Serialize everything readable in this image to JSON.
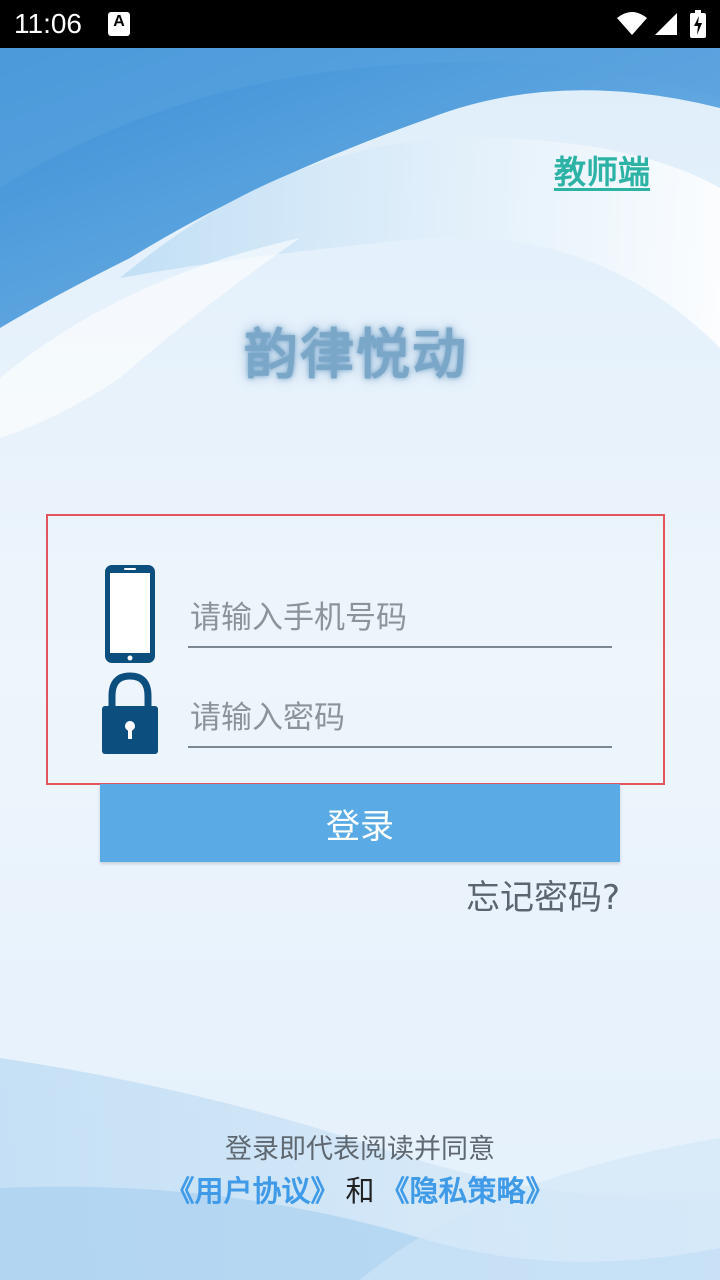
{
  "status_bar": {
    "time": "11:06",
    "notification_icon": "a-notification-icon",
    "wifi_icon": "wifi-icon",
    "signal_icon": "signal-icon",
    "battery_icon": "battery-charging-icon"
  },
  "header": {
    "teacher_link": "教师端"
  },
  "app": {
    "title": "韵律悦动"
  },
  "form": {
    "phone_placeholder": "请输入手机号码",
    "phone_value": "",
    "password_placeholder": "请输入密码",
    "password_value": "",
    "phone_icon": "phone-icon",
    "lock_icon": "lock-icon",
    "login_label": "登录",
    "forgot_label": "忘记密码?"
  },
  "agreement": {
    "text": "登录即代表阅读并同意",
    "user_agreement": "《用户协议》",
    "and": "和",
    "privacy_policy": "《隐私策略》"
  },
  "colors": {
    "accent": "#5aabe5",
    "teacher_link": "#2cb3a6",
    "highlight_border": "#e2555c",
    "agreement_link": "#3f9ae8",
    "icon": "#0c4f7f"
  }
}
